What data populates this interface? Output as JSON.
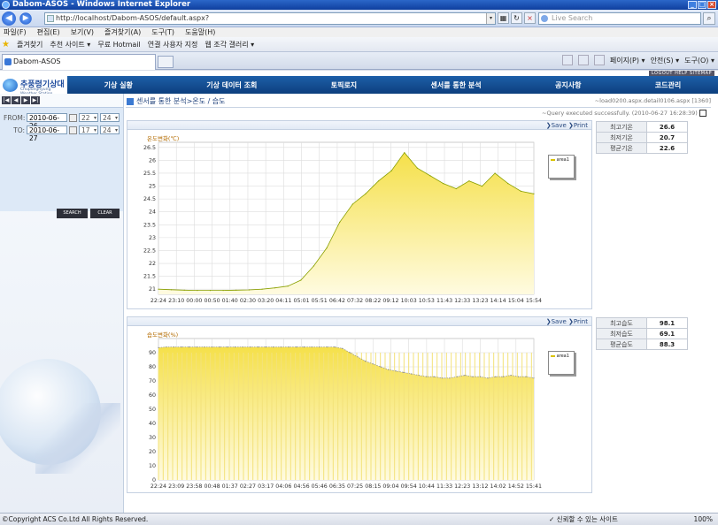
{
  "window": {
    "title": "Dabom-ASOS - Windows Internet Explorer"
  },
  "browser": {
    "url": "http://localhost/Dabom-ASOS/default.aspx?",
    "search_placeholder": "Live Search",
    "menu": [
      "파일(F)",
      "편집(E)",
      "보기(V)",
      "즐겨찾기(A)",
      "도구(T)",
      "도움말(H)"
    ],
    "favorites": [
      "즐겨찾기",
      "추천 사이트 ▾",
      "무료 Hotmail",
      "연결 사용자 지정",
      "웹 조각 갤러리 ▾"
    ],
    "tab_title": "Dabom-ASOS",
    "command": [
      "페이지(P) ▾",
      "안전(S) ▾",
      "도구(O) ▾"
    ],
    "status_left": "©Copyright ACS Co.Ltd All Rights Reserved.",
    "status_zone": "신뢰할 수 있는 사이트",
    "zoom": "100%"
  },
  "site": {
    "logo_name": "추풍령기상대",
    "logo_sub": "Chupungnyung Weather Station",
    "top_links": "LOGOUT  HELP  SITEMAP",
    "nav": [
      "기상 실황",
      "기상 데이터 조회",
      "토픽로지",
      "센서를 통한 분석",
      "공지사항",
      "코드관리"
    ]
  },
  "form": {
    "from_label": "FROM:",
    "from_date": "2010-06-26",
    "from_h1": "22",
    "from_h2": "24",
    "to_label": "TO:",
    "to_date": "2010-06-27",
    "to_h1": "17",
    "to_h2": "24",
    "search_label": "SEARCH",
    "clear_label": "CLEAR"
  },
  "breadcrumb": {
    "text": "센서를 통한 분석>온도 / 습도",
    "right": "~load0200.aspx.detail0106.aspx [1360]",
    "status": "~Query executed successfully. (2010-06-27 16:28:39)"
  },
  "links": {
    "save": "Save",
    "print": "Print"
  },
  "chart_data": [
    {
      "type": "area",
      "title": "온도변화(℃)",
      "legend": [
        "area1"
      ],
      "ylim": [
        20.8,
        26.7
      ],
      "yticks": [
        21,
        21.5,
        22,
        22.5,
        23,
        23.5,
        24,
        24.5,
        25,
        25.5,
        26,
        26.5
      ],
      "x": [
        "22:24",
        "23:10",
        "00:00",
        "00:50",
        "01:40",
        "02:30",
        "03:20",
        "04:11",
        "05:01",
        "05:51",
        "06:42",
        "07:32",
        "08:22",
        "09:12",
        "10:03",
        "10:53",
        "11:43",
        "12:33",
        "13:23",
        "14:14",
        "15:04",
        "15:54"
      ],
      "series": [
        {
          "name": "area1",
          "color": "#e8d200",
          "values": [
            21.0,
            20.98,
            20.96,
            20.95,
            20.95,
            20.95,
            20.96,
            20.97,
            21.0,
            21.05,
            21.12,
            21.35,
            21.9,
            22.6,
            23.6,
            24.3,
            24.7,
            25.2,
            25.6,
            26.3,
            25.7,
            25.4,
            25.1,
            24.9,
            25.2,
            25.0,
            25.5,
            25.1,
            24.8,
            24.7
          ]
        }
      ]
    },
    {
      "type": "area",
      "title": "습도변화(%)",
      "legend": [
        "area1"
      ],
      "ylim": [
        0,
        100
      ],
      "yticks": [
        0,
        10,
        20,
        30,
        40,
        50,
        60,
        70,
        80,
        90
      ],
      "x": [
        "22:24",
        "23:09",
        "23:58",
        "00:48",
        "01:37",
        "02:27",
        "03:17",
        "04:06",
        "04:56",
        "05:46",
        "06:35",
        "07:25",
        "08:15",
        "09:04",
        "09:54",
        "10:44",
        "11:33",
        "12:23",
        "13:12",
        "14:02",
        "14:52",
        "15:41"
      ],
      "series": [
        {
          "name": "area1",
          "color": "#e8d200",
          "values": [
            93.5,
            94,
            94,
            94,
            94,
            94,
            94,
            94,
            94,
            94,
            94,
            94,
            94,
            94,
            94,
            94,
            94,
            94,
            94,
            94,
            94,
            94,
            94,
            94,
            93,
            90,
            87,
            84,
            82,
            80,
            78,
            77,
            76,
            75,
            74,
            73,
            73,
            72,
            72,
            73,
            74,
            73,
            73,
            72,
            73,
            73,
            74,
            73,
            73,
            72
          ]
        }
      ]
    }
  ],
  "stats_temp": [
    {
      "k": "최고기온",
      "v": "26.6"
    },
    {
      "k": "최저기온",
      "v": "20.7"
    },
    {
      "k": "평균기온",
      "v": "22.6"
    }
  ],
  "stats_hum": [
    {
      "k": "최고습도",
      "v": "98.1"
    },
    {
      "k": "최저습도",
      "v": "69.1"
    },
    {
      "k": "평균습도",
      "v": "88.3"
    }
  ]
}
